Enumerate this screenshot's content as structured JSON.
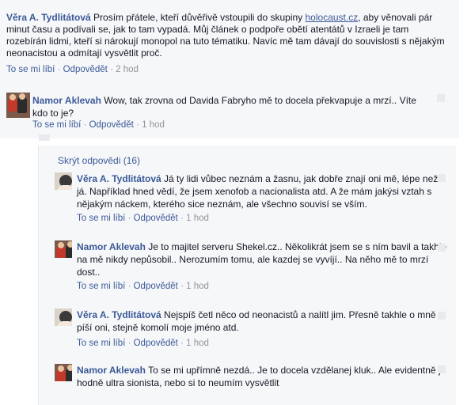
{
  "top_comment": {
    "author": "Věra A. Tydlitátová",
    "text_before_link": "Prosím přátele, kteří důvěřivě vstoupili do skupiny ",
    "link": "holocaust.cz",
    "text_after_link": ", aby věnovali pár minut času a podívali se, jak to tam vypadá. Můj článek o podpoře obětí atentátů v Izraeli je tam rozebírán lidmi, kteří si nárokují monopol na tuto tématiku. Navíc mě tam dávají do souvislosti s nějakým neonacistou a odmítají vysvětlit proč.",
    "like": "To se mi líbí",
    "reply": "Odpovědět",
    "time": "2 hod"
  },
  "comment2": {
    "author": "Namor Aklevah",
    "text": "Wow, tak zrovna od Davida Fabryho mě to docela překvapuje a mrzí.. Víte kdo to je?",
    "like": "To se mi líbí",
    "reply": "Odpovědět",
    "time": "1 hod"
  },
  "hide_replies_label": "Skrýt odpovědi (16)",
  "replies": [
    {
      "author": "Věra A. Tydlitátová",
      "text": "Já ty lidi vůbec neznám a žasnu, jak dobře znají oni mě, lépe než já. Například hned vědí, že jsem xenofob a nacionalista atd. A že mám jakýsi vztah s nějakým náckem, kterého sice neznám, ale všechno souvisí se vším.",
      "like": "To se mi líbí",
      "reply": "Odpovědět",
      "time": "1 hod"
    },
    {
      "author": "Namor Aklevah",
      "text": "Je to majitel serveru Shekel.cz.. Několikrát jsem se s ním bavil a takhle na mě nikdy nepůsobil.. Nerozumím tomu, ale kazdej se vyvíjí.. Na něho mě to mrzí dost..",
      "like": "To se mi líbí",
      "reply": "Odpovědět",
      "time": "1 hod"
    },
    {
      "author": "Věra A. Tydlitátová",
      "text": "Nejspíš četl něco od neonacistů a nalítl jim. Přesně takhle o mně píší oni, stejně komolí moje jméno atd.",
      "like": "To se mi líbí",
      "reply": "Odpovědět",
      "time": "1 hod"
    },
    {
      "author": "Namor Aklevah",
      "text": "To se mi upřímně nezdá.. Je to docela vzdělanej kluk.. Ale evidentně je hodně ultra sionista, nebo si to neumím vysvětlit",
      "like": "",
      "reply": "",
      "time": ""
    }
  ]
}
